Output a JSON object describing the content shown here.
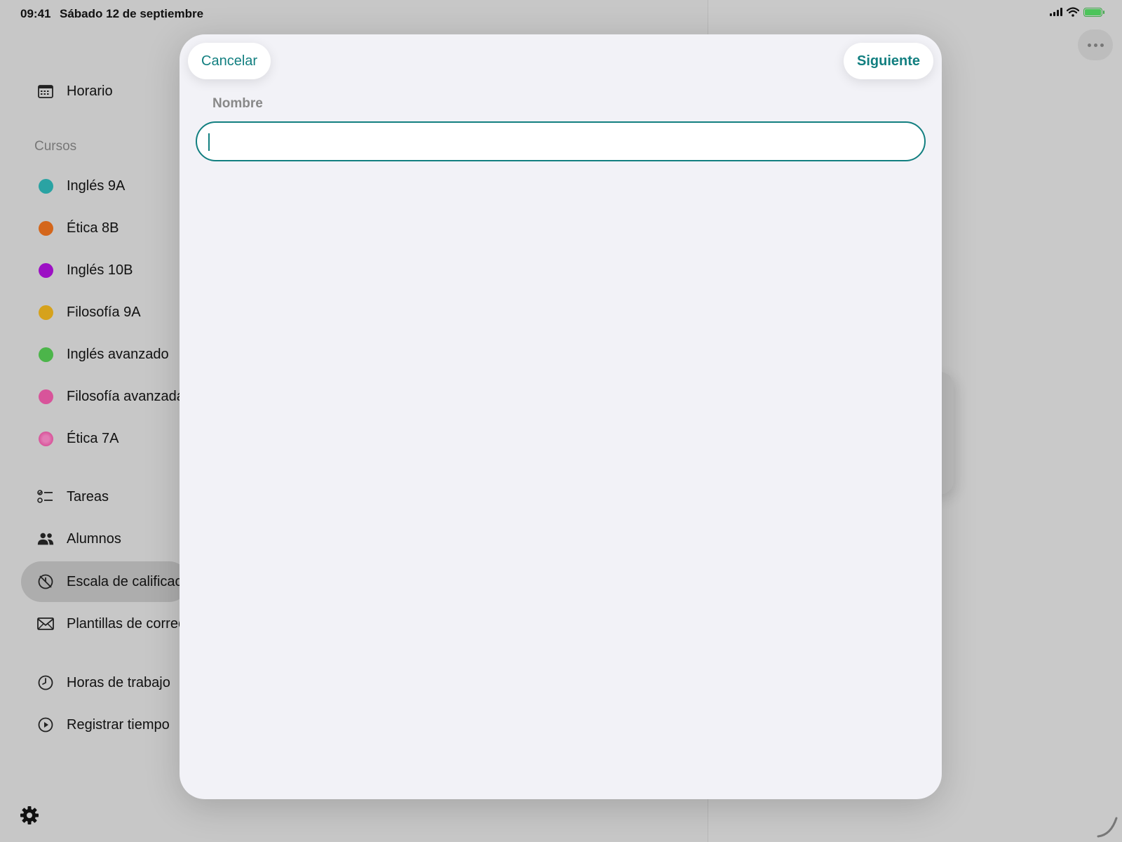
{
  "status_bar": {
    "time": "09:41",
    "date": "Sábado 12 de septiembre"
  },
  "sidebar": {
    "schedule": {
      "label": "Horario",
      "icon": "calendar-icon"
    },
    "courses_header": "Cursos",
    "courses": [
      {
        "label": "Inglés 9A",
        "color": "#2aa3a3"
      },
      {
        "label": "Ética 8B",
        "color": "#d4661b"
      },
      {
        "label": "Inglés 10B",
        "color": "#9c10c4"
      },
      {
        "label": "Filosofía 9A",
        "color": "#d6a21c"
      },
      {
        "label": "Inglés avanzado",
        "color": "#4cb54a"
      },
      {
        "label": "Filosofía avanzada",
        "color": "#d8549a"
      },
      {
        "label": "Ética 7A",
        "color": "#d8549a"
      }
    ],
    "tools": [
      {
        "label": "Tareas",
        "icon": "tasks-icon"
      },
      {
        "label": "Alumnos",
        "icon": "students-icon"
      },
      {
        "label": "Escala de calificac",
        "icon": "grade-scale-icon",
        "selected": true
      },
      {
        "label": "Plantillas de correo",
        "icon": "mail-icon"
      }
    ],
    "time_items": [
      {
        "label": "Horas de trabajo",
        "icon": "clock-icon"
      },
      {
        "label": "Registrar tiempo",
        "icon": "play-circle-icon"
      }
    ],
    "settings_icon": "gear-icon"
  },
  "modal": {
    "cancel_label": "Cancelar",
    "next_label": "Siguiente",
    "field_label": "Nombre",
    "field_value": "",
    "field_placeholder": "",
    "accent_color": "#127f80"
  }
}
